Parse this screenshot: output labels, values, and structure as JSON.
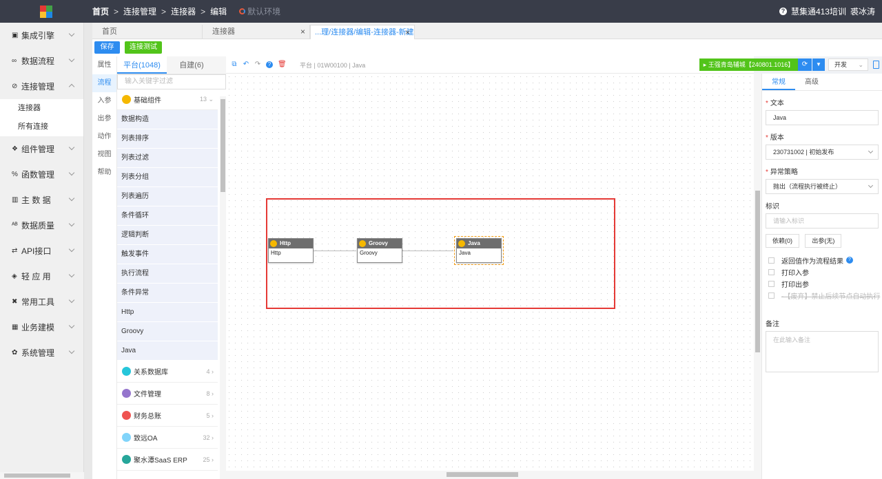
{
  "header": {
    "breadcrumb": [
      "首页",
      "连接管理",
      "连接器",
      "编辑"
    ],
    "environment": "默认环境",
    "user_org": "慧集通413培训",
    "user_name": "裘冰涛"
  },
  "sidebar": {
    "items": [
      {
        "label": "集成引擎",
        "icon": "engine-icon"
      },
      {
        "label": "数据流程",
        "icon": "infinity-icon"
      },
      {
        "label": "连接管理",
        "icon": "link-icon",
        "expanded": true
      },
      {
        "label": "组件管理",
        "icon": "component-icon"
      },
      {
        "label": "函数管理",
        "icon": "function-icon"
      },
      {
        "label": "主 数 据",
        "icon": "map-icon"
      },
      {
        "label": "数据质量",
        "icon": "quality-icon"
      },
      {
        "label": "API接口",
        "icon": "api-icon"
      },
      {
        "label": "轻 应 用",
        "icon": "box-icon"
      },
      {
        "label": "常用工具",
        "icon": "tools-icon"
      },
      {
        "label": "业务建模",
        "icon": "table-icon"
      },
      {
        "label": "系统管理",
        "icon": "gear-icon"
      }
    ],
    "submenu": [
      "连接器",
      "所有连接"
    ]
  },
  "tabs": [
    {
      "label": "首页"
    },
    {
      "label": "连接器"
    },
    {
      "label": "...理/连接器/编辑-连接器-新建"
    }
  ],
  "actions": {
    "save": "保存",
    "test": "连接测试"
  },
  "vertical_tabs": [
    "属性",
    "流程",
    "入参",
    "出参",
    "动作",
    "视图",
    "帮助"
  ],
  "palette": {
    "tab_platform": "平台(1048)",
    "tab_custom": "自建(6)",
    "search_placeholder": "输入关键字过滤",
    "base_group": {
      "label": "基础组件",
      "count": "13"
    },
    "components": [
      "数据构造",
      "列表排序",
      "列表过滤",
      "列表分组",
      "列表遍历",
      "条件循环",
      "逻辑判断",
      "触发事件",
      "执行流程",
      "条件异常",
      "Http",
      "Groovy",
      "Java"
    ],
    "groups": [
      {
        "label": "关系数据库",
        "count": "4",
        "color": "#26c6da"
      },
      {
        "label": "文件管理",
        "count": "8",
        "color": "#9575cd"
      },
      {
        "label": "财务总账",
        "count": "5",
        "color": "#ef5350"
      },
      {
        "label": "致远OA",
        "count": "32",
        "color": "#81d4fa"
      },
      {
        "label": "聚水潭SaaS ERP",
        "count": "25",
        "color": "#26a69a"
      }
    ]
  },
  "canvas": {
    "info": "平台 | 01W00100 | Java",
    "run_label": "王强青岛辅城【240801.1016】",
    "env_select": "开发",
    "nodes": [
      {
        "title": "Http",
        "body": "Http"
      },
      {
        "title": "Groovy",
        "body": "Groovy"
      },
      {
        "title": "Java",
        "body": "Java"
      }
    ]
  },
  "props": {
    "tab_general": "常规",
    "tab_advanced": "高级",
    "text_label": "文本",
    "text_value": "Java",
    "version_label": "版本",
    "version_value": "230731002 | 初始发布",
    "exception_label": "异常策略",
    "exception_value": "抛出（流程执行被终止）",
    "tag_label": "标识",
    "tag_placeholder": "请输入标识",
    "dep_btn": "依赖(0)",
    "out_btn": "出参(无)",
    "checks": [
      "返回值作为流程结果",
      "打印入参",
      "打印出参",
      "-【废弃】禁止后续节点自动执行"
    ],
    "remark_label": "备注",
    "remark_placeholder": "在此输入备注"
  }
}
